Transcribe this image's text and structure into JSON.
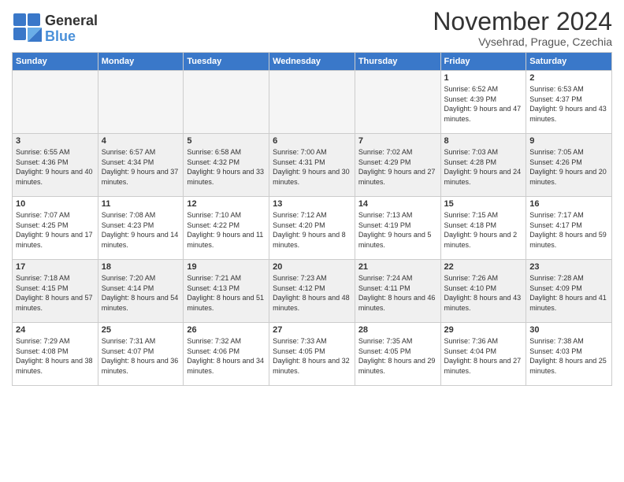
{
  "logo": {
    "line1": "General",
    "line2": "Blue"
  },
  "title": "November 2024",
  "subtitle": "Vysehrad, Prague, Czechia",
  "days_of_week": [
    "Sunday",
    "Monday",
    "Tuesday",
    "Wednesday",
    "Thursday",
    "Friday",
    "Saturday"
  ],
  "weeks": [
    [
      {
        "num": "",
        "info": ""
      },
      {
        "num": "",
        "info": ""
      },
      {
        "num": "",
        "info": ""
      },
      {
        "num": "",
        "info": ""
      },
      {
        "num": "",
        "info": ""
      },
      {
        "num": "1",
        "info": "Sunrise: 6:52 AM\nSunset: 4:39 PM\nDaylight: 9 hours and 47 minutes."
      },
      {
        "num": "2",
        "info": "Sunrise: 6:53 AM\nSunset: 4:37 PM\nDaylight: 9 hours and 43 minutes."
      }
    ],
    [
      {
        "num": "3",
        "info": "Sunrise: 6:55 AM\nSunset: 4:36 PM\nDaylight: 9 hours and 40 minutes."
      },
      {
        "num": "4",
        "info": "Sunrise: 6:57 AM\nSunset: 4:34 PM\nDaylight: 9 hours and 37 minutes."
      },
      {
        "num": "5",
        "info": "Sunrise: 6:58 AM\nSunset: 4:32 PM\nDaylight: 9 hours and 33 minutes."
      },
      {
        "num": "6",
        "info": "Sunrise: 7:00 AM\nSunset: 4:31 PM\nDaylight: 9 hours and 30 minutes."
      },
      {
        "num": "7",
        "info": "Sunrise: 7:02 AM\nSunset: 4:29 PM\nDaylight: 9 hours and 27 minutes."
      },
      {
        "num": "8",
        "info": "Sunrise: 7:03 AM\nSunset: 4:28 PM\nDaylight: 9 hours and 24 minutes."
      },
      {
        "num": "9",
        "info": "Sunrise: 7:05 AM\nSunset: 4:26 PM\nDaylight: 9 hours and 20 minutes."
      }
    ],
    [
      {
        "num": "10",
        "info": "Sunrise: 7:07 AM\nSunset: 4:25 PM\nDaylight: 9 hours and 17 minutes."
      },
      {
        "num": "11",
        "info": "Sunrise: 7:08 AM\nSunset: 4:23 PM\nDaylight: 9 hours and 14 minutes."
      },
      {
        "num": "12",
        "info": "Sunrise: 7:10 AM\nSunset: 4:22 PM\nDaylight: 9 hours and 11 minutes."
      },
      {
        "num": "13",
        "info": "Sunrise: 7:12 AM\nSunset: 4:20 PM\nDaylight: 9 hours and 8 minutes."
      },
      {
        "num": "14",
        "info": "Sunrise: 7:13 AM\nSunset: 4:19 PM\nDaylight: 9 hours and 5 minutes."
      },
      {
        "num": "15",
        "info": "Sunrise: 7:15 AM\nSunset: 4:18 PM\nDaylight: 9 hours and 2 minutes."
      },
      {
        "num": "16",
        "info": "Sunrise: 7:17 AM\nSunset: 4:17 PM\nDaylight: 8 hours and 59 minutes."
      }
    ],
    [
      {
        "num": "17",
        "info": "Sunrise: 7:18 AM\nSunset: 4:15 PM\nDaylight: 8 hours and 57 minutes."
      },
      {
        "num": "18",
        "info": "Sunrise: 7:20 AM\nSunset: 4:14 PM\nDaylight: 8 hours and 54 minutes."
      },
      {
        "num": "19",
        "info": "Sunrise: 7:21 AM\nSunset: 4:13 PM\nDaylight: 8 hours and 51 minutes."
      },
      {
        "num": "20",
        "info": "Sunrise: 7:23 AM\nSunset: 4:12 PM\nDaylight: 8 hours and 48 minutes."
      },
      {
        "num": "21",
        "info": "Sunrise: 7:24 AM\nSunset: 4:11 PM\nDaylight: 8 hours and 46 minutes."
      },
      {
        "num": "22",
        "info": "Sunrise: 7:26 AM\nSunset: 4:10 PM\nDaylight: 8 hours and 43 minutes."
      },
      {
        "num": "23",
        "info": "Sunrise: 7:28 AM\nSunset: 4:09 PM\nDaylight: 8 hours and 41 minutes."
      }
    ],
    [
      {
        "num": "24",
        "info": "Sunrise: 7:29 AM\nSunset: 4:08 PM\nDaylight: 8 hours and 38 minutes."
      },
      {
        "num": "25",
        "info": "Sunrise: 7:31 AM\nSunset: 4:07 PM\nDaylight: 8 hours and 36 minutes."
      },
      {
        "num": "26",
        "info": "Sunrise: 7:32 AM\nSunset: 4:06 PM\nDaylight: 8 hours and 34 minutes."
      },
      {
        "num": "27",
        "info": "Sunrise: 7:33 AM\nSunset: 4:05 PM\nDaylight: 8 hours and 32 minutes."
      },
      {
        "num": "28",
        "info": "Sunrise: 7:35 AM\nSunset: 4:05 PM\nDaylight: 8 hours and 29 minutes."
      },
      {
        "num": "29",
        "info": "Sunrise: 7:36 AM\nSunset: 4:04 PM\nDaylight: 8 hours and 27 minutes."
      },
      {
        "num": "30",
        "info": "Sunrise: 7:38 AM\nSunset: 4:03 PM\nDaylight: 8 hours and 25 minutes."
      }
    ]
  ]
}
